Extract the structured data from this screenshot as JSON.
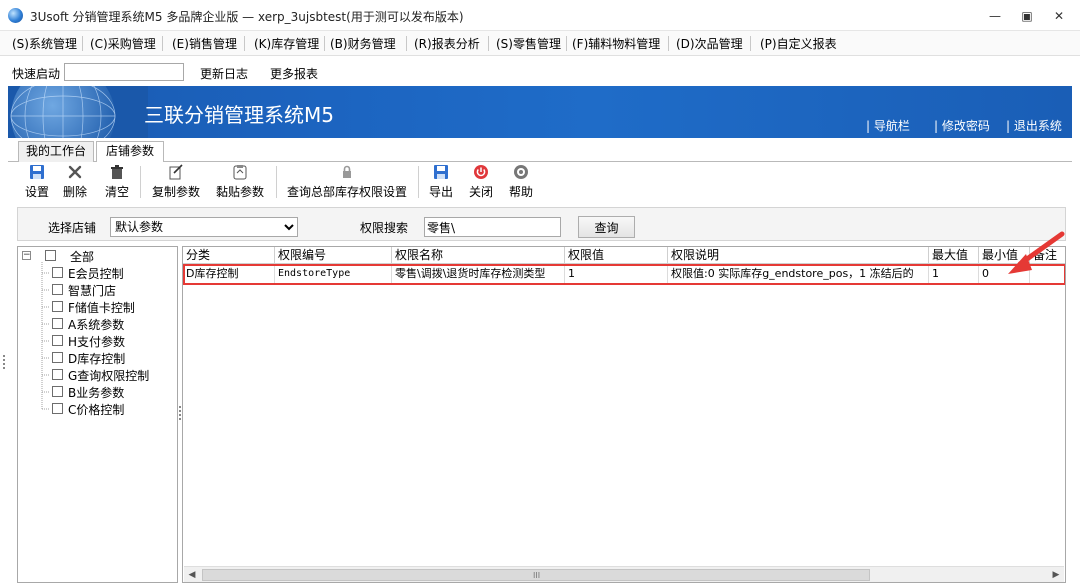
{
  "window": {
    "title": "3Usoft 分销管理系统M5 多品牌企业版 — xerp_3ujsbtest(用于测可以发布版本)",
    "controls": [
      "minimize",
      "maximize",
      "close"
    ]
  },
  "menu": [
    "(S)系统管理",
    "(C)采购管理",
    "(E)销售管理",
    "(K)库存管理",
    "(B)财务管理",
    "(R)报表分析",
    "(S)零售管理",
    "(F)辅料物料管理",
    "(D)次品管理",
    "(P)自定义报表"
  ],
  "quickbar": {
    "label": "快速启动",
    "input_value": "",
    "links": [
      "更新日志",
      "更多报表"
    ]
  },
  "banner": {
    "title": "三联分销管理系统M5",
    "links": [
      "导航栏",
      "修改密码",
      "退出系统"
    ]
  },
  "tabs": [
    {
      "label": "我的工作台",
      "active": false
    },
    {
      "label": "店铺参数",
      "active": true
    }
  ],
  "toolbar": [
    {
      "label": "设置",
      "icon": "save-icon"
    },
    {
      "label": "删除",
      "icon": "delete-icon"
    },
    {
      "label": "清空",
      "icon": "trash-icon"
    },
    {
      "label": "复制参数",
      "icon": "copy-icon"
    },
    {
      "label": "黏贴参数",
      "icon": "paste-icon"
    },
    {
      "label": "查询总部库存权限设置",
      "icon": "lock-icon"
    },
    {
      "label": "导出",
      "icon": "export-icon"
    },
    {
      "label": "关闭",
      "icon": "power-icon"
    },
    {
      "label": "帮助",
      "icon": "help-icon"
    }
  ],
  "filter": {
    "store_label": "选择店铺",
    "store_value": "默认参数",
    "search_label": "权限搜索",
    "search_value": "零售\\",
    "query_button": "查询"
  },
  "tree": {
    "root": "全部",
    "items": [
      "E会员控制",
      "智慧门店",
      "F储值卡控制",
      "A系统参数",
      "H支付参数",
      "D库存控制",
      "G查询权限控制",
      "B业务参数",
      "C价格控制"
    ]
  },
  "grid": {
    "columns": [
      "分类",
      "权限编号",
      "权限名称",
      "权限值",
      "权限说明",
      "最大值",
      "最小值",
      "备注"
    ],
    "rows": [
      [
        "D库存控制",
        "EndstoreType",
        "零售\\调拨\\退货时库存检测类型",
        "1",
        "权限值:0 实际库存g_endstore_pos，1 冻结后的",
        "1",
        "0",
        ""
      ]
    ]
  },
  "colors": {
    "banner": "#1c64c0",
    "highlight_border": "#e53935",
    "arrow": "#e53935"
  }
}
